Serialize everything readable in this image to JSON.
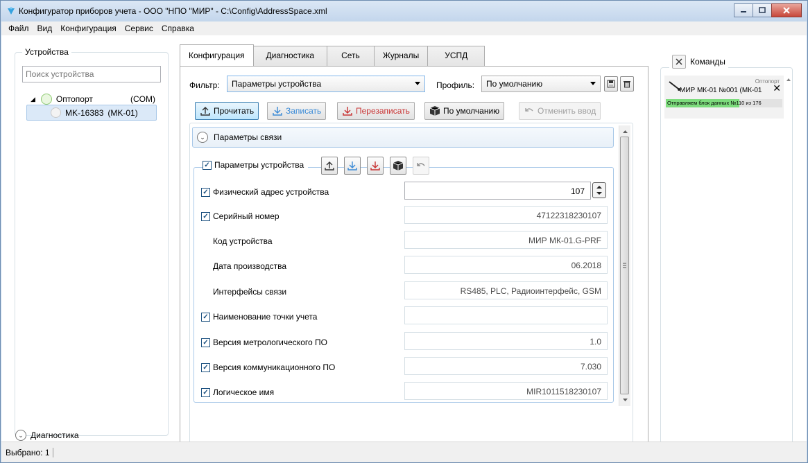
{
  "window": {
    "title": "Конфигуратор приборов учета - ООО \"НПО \"МИР\" - C:\\Config\\AddressSpace.xml"
  },
  "menu": [
    "Файл",
    "Вид",
    "Конфигурация",
    "Сервис",
    "Справка"
  ],
  "devices": {
    "group_label": "Устройства",
    "search_placeholder": "Поиск устройства",
    "tree": {
      "root": {
        "name": "Оптопорт",
        "type": "(COM)"
      },
      "child": {
        "name": "MK-16383",
        "type": "(MK-01)"
      }
    }
  },
  "tabs": [
    "Конфигурация",
    "Диагностика",
    "Сеть",
    "Журналы",
    "УСПД"
  ],
  "filter": {
    "label": "Фильтр:",
    "value": "Параметры устройства"
  },
  "profile": {
    "label": "Профиль:",
    "value": "По умолчанию"
  },
  "toolbar": {
    "read": "Прочитать",
    "write": "Записать",
    "overwrite": "Перезаписать",
    "default": "По умолчанию",
    "cancel": "Отменить ввод"
  },
  "connection_params": {
    "label": "Параметры связи"
  },
  "device_params": {
    "label": "Параметры устройства",
    "rows": [
      {
        "label": "Физический адрес устройства",
        "value": "107",
        "checkbox": true
      },
      {
        "label": "Серийный номер",
        "value": "47122318230107",
        "checkbox": true
      },
      {
        "label": "Код устройства",
        "value": "МИР МК-01.G-PRF",
        "checkbox": false
      },
      {
        "label": "Дата производства",
        "value": "06.2018",
        "checkbox": false
      },
      {
        "label": "Интерфейсы связи",
        "value": "RS485, PLC, Радиоинтерфейс, GSM",
        "checkbox": false
      },
      {
        "label": "Наименование точки учета",
        "value": "",
        "checkbox": true
      },
      {
        "label": "Версия метрологического ПО",
        "value": "1.0",
        "checkbox": true
      },
      {
        "label": "Версия коммуникационного ПО",
        "value": "7.030",
        "checkbox": true
      },
      {
        "label": "Логическое имя",
        "value": "MIR1011518230107",
        "checkbox": true
      }
    ]
  },
  "commands": {
    "label": "Команды",
    "item": {
      "port": "Оптопорт",
      "device": "МИР МК-01 №001 (МК-01",
      "progress_text": "Отправляем блок данных №110 из 176",
      "progress": 0.63
    }
  },
  "diagnostics": {
    "label": "Диагностика"
  },
  "status": {
    "selected": "Выбрано: 1"
  },
  "colors": {
    "accent": "#3c7fb1",
    "progress": "#7ddc7d",
    "online": "#b8e6a0"
  }
}
